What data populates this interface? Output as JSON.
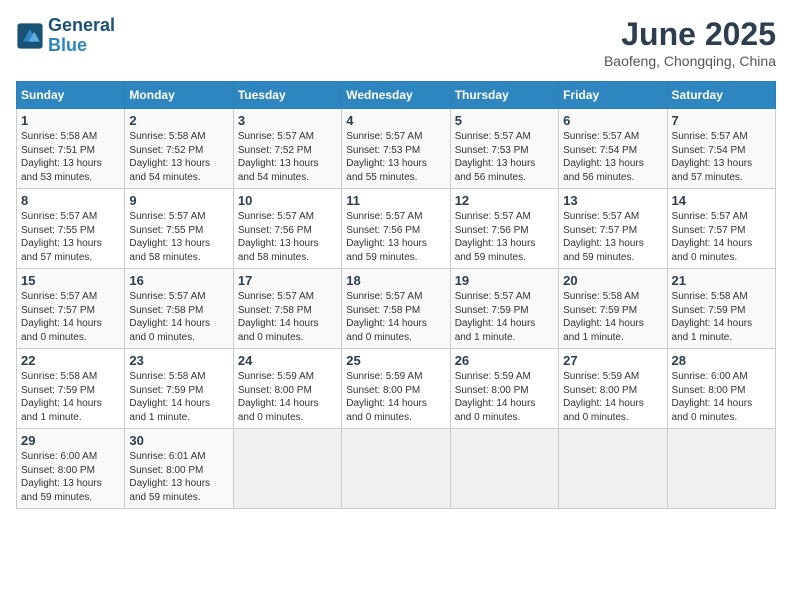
{
  "header": {
    "logo_line1": "General",
    "logo_line2": "Blue",
    "month_year": "June 2025",
    "location": "Baofeng, Chongqing, China"
  },
  "weekdays": [
    "Sunday",
    "Monday",
    "Tuesday",
    "Wednesday",
    "Thursday",
    "Friday",
    "Saturday"
  ],
  "weeks": [
    [
      {
        "day": "1",
        "info": "Sunrise: 5:58 AM\nSunset: 7:51 PM\nDaylight: 13 hours\nand 53 minutes."
      },
      {
        "day": "2",
        "info": "Sunrise: 5:58 AM\nSunset: 7:52 PM\nDaylight: 13 hours\nand 54 minutes."
      },
      {
        "day": "3",
        "info": "Sunrise: 5:57 AM\nSunset: 7:52 PM\nDaylight: 13 hours\nand 54 minutes."
      },
      {
        "day": "4",
        "info": "Sunrise: 5:57 AM\nSunset: 7:53 PM\nDaylight: 13 hours\nand 55 minutes."
      },
      {
        "day": "5",
        "info": "Sunrise: 5:57 AM\nSunset: 7:53 PM\nDaylight: 13 hours\nand 56 minutes."
      },
      {
        "day": "6",
        "info": "Sunrise: 5:57 AM\nSunset: 7:54 PM\nDaylight: 13 hours\nand 56 minutes."
      },
      {
        "day": "7",
        "info": "Sunrise: 5:57 AM\nSunset: 7:54 PM\nDaylight: 13 hours\nand 57 minutes."
      }
    ],
    [
      {
        "day": "8",
        "info": "Sunrise: 5:57 AM\nSunset: 7:55 PM\nDaylight: 13 hours\nand 57 minutes."
      },
      {
        "day": "9",
        "info": "Sunrise: 5:57 AM\nSunset: 7:55 PM\nDaylight: 13 hours\nand 58 minutes."
      },
      {
        "day": "10",
        "info": "Sunrise: 5:57 AM\nSunset: 7:56 PM\nDaylight: 13 hours\nand 58 minutes."
      },
      {
        "day": "11",
        "info": "Sunrise: 5:57 AM\nSunset: 7:56 PM\nDaylight: 13 hours\nand 59 minutes."
      },
      {
        "day": "12",
        "info": "Sunrise: 5:57 AM\nSunset: 7:56 PM\nDaylight: 13 hours\nand 59 minutes."
      },
      {
        "day": "13",
        "info": "Sunrise: 5:57 AM\nSunset: 7:57 PM\nDaylight: 13 hours\nand 59 minutes."
      },
      {
        "day": "14",
        "info": "Sunrise: 5:57 AM\nSunset: 7:57 PM\nDaylight: 14 hours\nand 0 minutes."
      }
    ],
    [
      {
        "day": "15",
        "info": "Sunrise: 5:57 AM\nSunset: 7:57 PM\nDaylight: 14 hours\nand 0 minutes."
      },
      {
        "day": "16",
        "info": "Sunrise: 5:57 AM\nSunset: 7:58 PM\nDaylight: 14 hours\nand 0 minutes."
      },
      {
        "day": "17",
        "info": "Sunrise: 5:57 AM\nSunset: 7:58 PM\nDaylight: 14 hours\nand 0 minutes."
      },
      {
        "day": "18",
        "info": "Sunrise: 5:57 AM\nSunset: 7:58 PM\nDaylight: 14 hours\nand 0 minutes."
      },
      {
        "day": "19",
        "info": "Sunrise: 5:57 AM\nSunset: 7:59 PM\nDaylight: 14 hours\nand 1 minute."
      },
      {
        "day": "20",
        "info": "Sunrise: 5:58 AM\nSunset: 7:59 PM\nDaylight: 14 hours\nand 1 minute."
      },
      {
        "day": "21",
        "info": "Sunrise: 5:58 AM\nSunset: 7:59 PM\nDaylight: 14 hours\nand 1 minute."
      }
    ],
    [
      {
        "day": "22",
        "info": "Sunrise: 5:58 AM\nSunset: 7:59 PM\nDaylight: 14 hours\nand 1 minute."
      },
      {
        "day": "23",
        "info": "Sunrise: 5:58 AM\nSunset: 7:59 PM\nDaylight: 14 hours\nand 1 minute."
      },
      {
        "day": "24",
        "info": "Sunrise: 5:59 AM\nSunset: 8:00 PM\nDaylight: 14 hours\nand 0 minutes."
      },
      {
        "day": "25",
        "info": "Sunrise: 5:59 AM\nSunset: 8:00 PM\nDaylight: 14 hours\nand 0 minutes."
      },
      {
        "day": "26",
        "info": "Sunrise: 5:59 AM\nSunset: 8:00 PM\nDaylight: 14 hours\nand 0 minutes."
      },
      {
        "day": "27",
        "info": "Sunrise: 5:59 AM\nSunset: 8:00 PM\nDaylight: 14 hours\nand 0 minutes."
      },
      {
        "day": "28",
        "info": "Sunrise: 6:00 AM\nSunset: 8:00 PM\nDaylight: 14 hours\nand 0 minutes."
      }
    ],
    [
      {
        "day": "29",
        "info": "Sunrise: 6:00 AM\nSunset: 8:00 PM\nDaylight: 13 hours\nand 59 minutes."
      },
      {
        "day": "30",
        "info": "Sunrise: 6:01 AM\nSunset: 8:00 PM\nDaylight: 13 hours\nand 59 minutes."
      },
      {
        "day": "",
        "info": ""
      },
      {
        "day": "",
        "info": ""
      },
      {
        "day": "",
        "info": ""
      },
      {
        "day": "",
        "info": ""
      },
      {
        "day": "",
        "info": ""
      }
    ]
  ]
}
